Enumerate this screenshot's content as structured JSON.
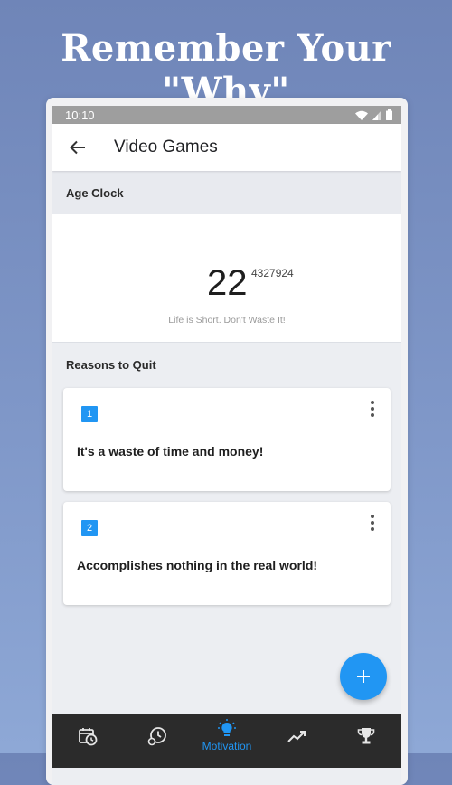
{
  "banner": {
    "headline": "Remember Your \"Why\""
  },
  "status_bar": {
    "time": "10:10"
  },
  "app_bar": {
    "title": "Video Games"
  },
  "age_clock": {
    "header": "Age Clock",
    "years": "22",
    "seconds": "4327924",
    "tagline": "Life is Short. Don't Waste It!"
  },
  "reasons": {
    "header": "Reasons to Quit",
    "items": [
      {
        "number": "1",
        "text": "It's a waste of time and money!"
      },
      {
        "number": "2",
        "text": "Accomplishes nothing in the real world!"
      }
    ]
  },
  "bottom_nav": {
    "items": [
      {
        "icon": "calendar-clock-icon",
        "label": ""
      },
      {
        "icon": "history-icon",
        "label": ""
      },
      {
        "icon": "lightbulb-icon",
        "label": "Motivation"
      },
      {
        "icon": "trending-up-icon",
        "label": ""
      },
      {
        "icon": "trophy-icon",
        "label": ""
      }
    ],
    "active_index": 2
  },
  "colors": {
    "accent": "#2196f3",
    "status_bar": "#9e9e9e",
    "nav_background": "#2b2b2b",
    "page_background": "#7f97c8"
  }
}
